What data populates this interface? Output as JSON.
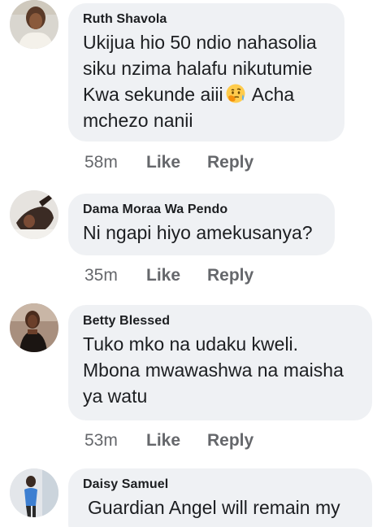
{
  "comments": [
    {
      "author": "Ruth Shavola",
      "text_before_emoji": "Ukijua hio 50 ndio nahasolia\nsiku nzima halafu nikutumie\nKwa sekunde aiii",
      "emoji": "thinking-face-emoji",
      "text_after_emoji": " Acha\nmchezo nanii",
      "time": "58m",
      "like": "Like",
      "reply": "Reply"
    },
    {
      "author": "Dama Moraa Wa Pendo",
      "text": "Ni ngapi hiyo amekusanya?",
      "time": "35m",
      "like": "Like",
      "reply": "Reply"
    },
    {
      "author": "Betty Blessed",
      "text": "Tuko mko na udaku kweli.\nMbona mwawashwa na maisha\nya watu",
      "time": "53m",
      "like": "Like",
      "reply": "Reply"
    },
    {
      "author": "Daisy Samuel",
      "text": "Guardian Angel will remain my"
    }
  ],
  "colors": {
    "bubble": "#eff1f4",
    "text": "#1c1e21",
    "secondary": "#65676b"
  }
}
